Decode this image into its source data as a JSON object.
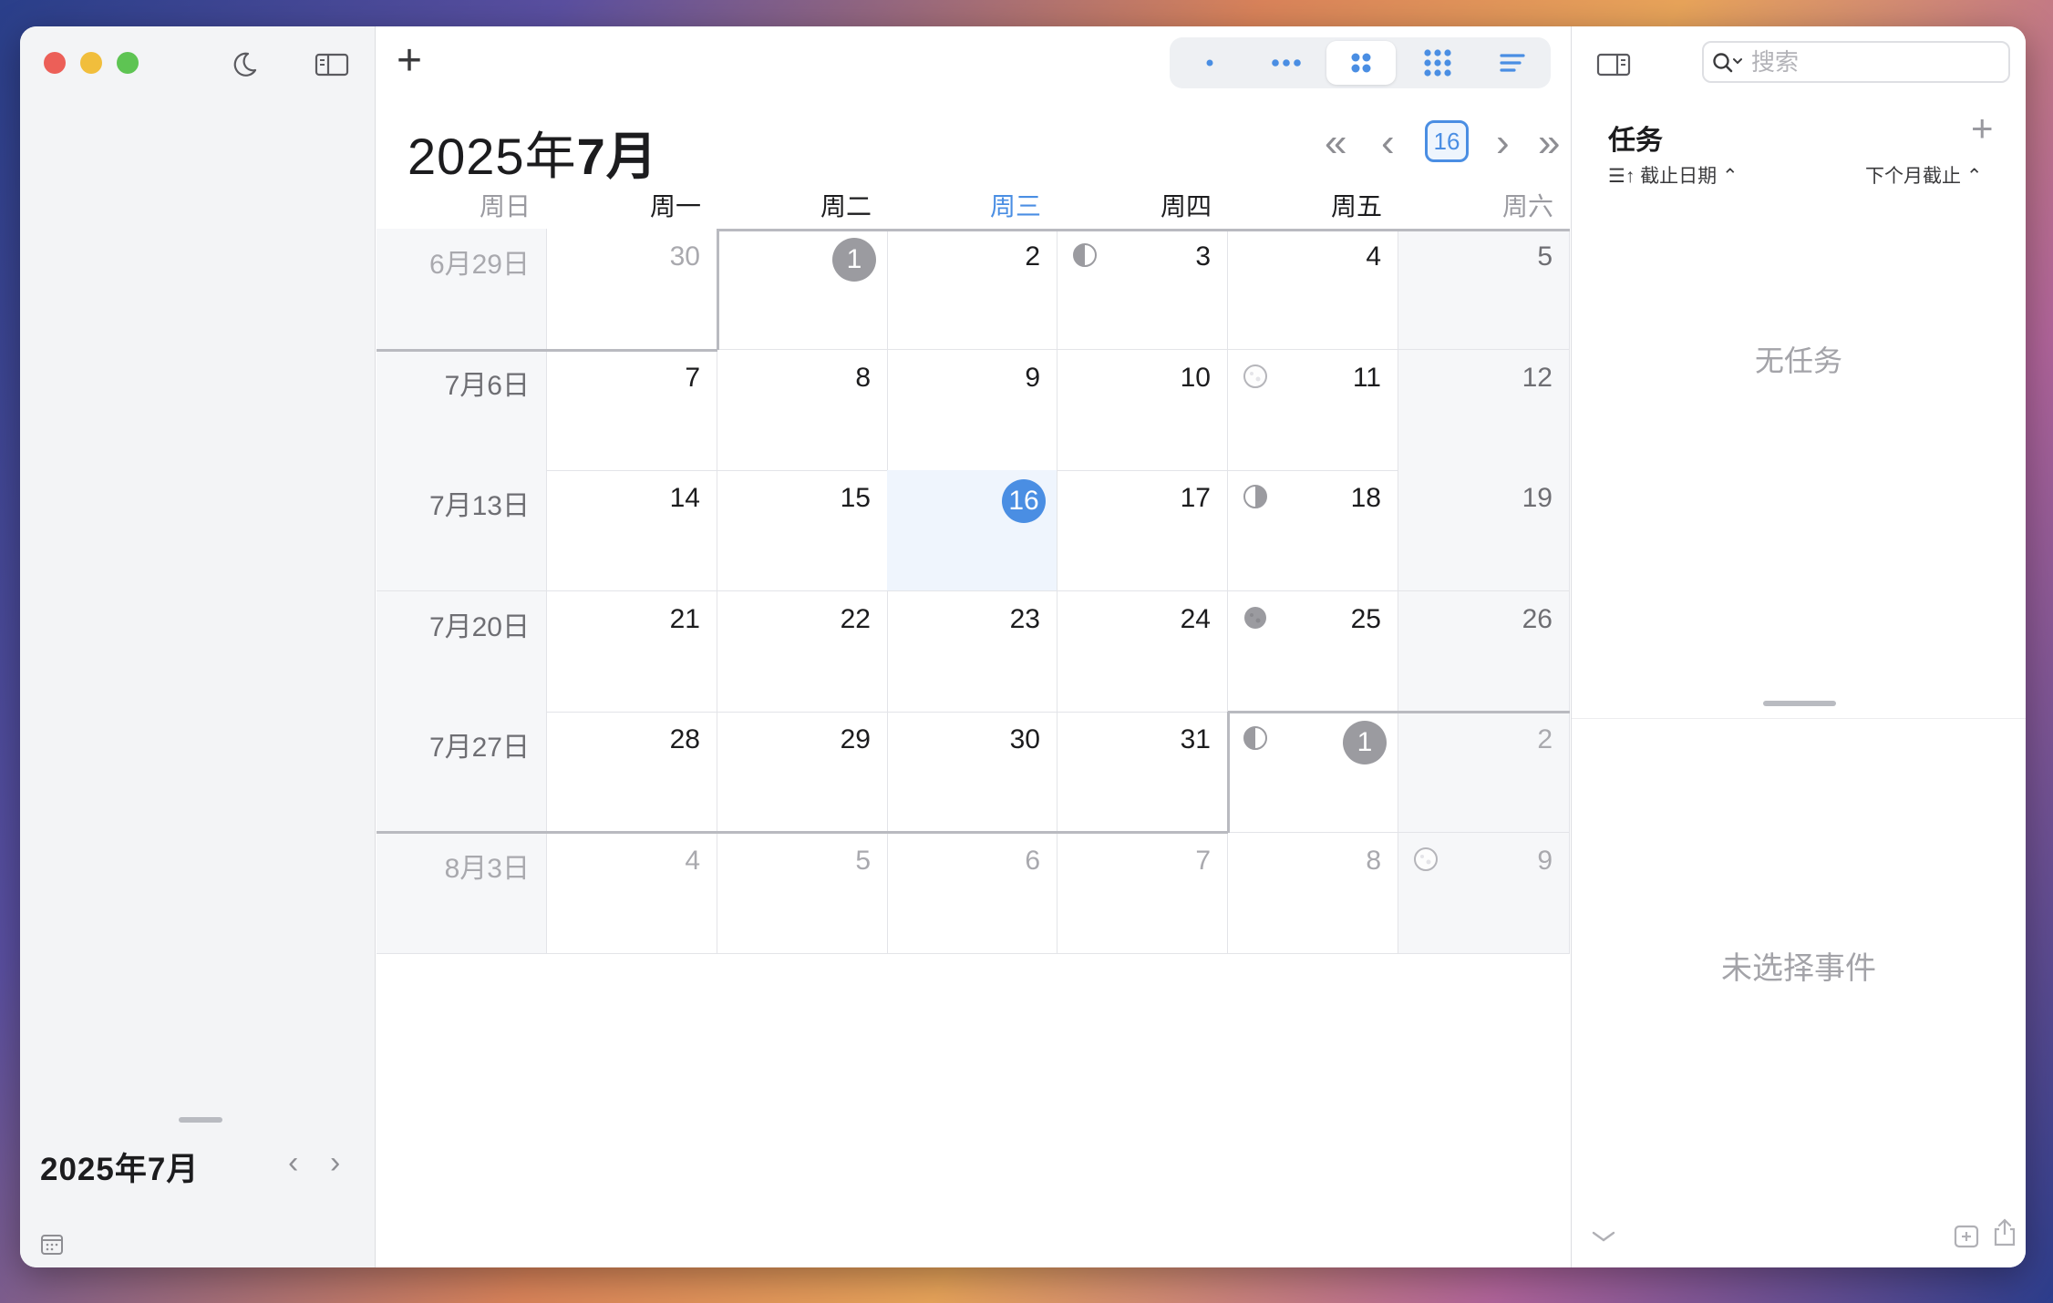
{
  "window": {
    "title": "2025年7月"
  },
  "toolbar": {
    "add_label": "+",
    "view_modes": [
      {
        "name": "view-day",
        "icon": "single-dot-icon",
        "active": false
      },
      {
        "name": "view-week",
        "icon": "three-dots-icon",
        "active": false
      },
      {
        "name": "view-month",
        "icon": "four-dots-icon",
        "active": true
      },
      {
        "name": "view-year",
        "icon": "nine-dots-icon",
        "active": false
      },
      {
        "name": "view-list",
        "icon": "lines-icon",
        "active": false
      }
    ]
  },
  "header": {
    "year_part": "2025年",
    "month_part": "7月",
    "today_badge": "16",
    "nav_prev_far": "«",
    "nav_prev": "‹",
    "nav_next": "›",
    "nav_next_far": "»"
  },
  "weekdays": [
    "周日",
    "周一",
    "周二",
    "周三",
    "周四",
    "周五",
    "周六"
  ],
  "weeks": [
    [
      {
        "label": "6月29日",
        "other": true
      },
      {
        "label": "30",
        "other": true
      },
      {
        "label": "1",
        "circle": true
      },
      {
        "label": "2"
      },
      {
        "label": "3",
        "moon": "first-quarter"
      },
      {
        "label": "4"
      },
      {
        "label": "5"
      }
    ],
    [
      {
        "label": "7月6日"
      },
      {
        "label": "7"
      },
      {
        "label": "8"
      },
      {
        "label": "9"
      },
      {
        "label": "10"
      },
      {
        "label": "11",
        "moon": "full"
      },
      {
        "label": "12"
      }
    ],
    [
      {
        "label": "7月13日"
      },
      {
        "label": "14"
      },
      {
        "label": "15"
      },
      {
        "label": "16",
        "today": true
      },
      {
        "label": "17"
      },
      {
        "label": "18",
        "moon": "last-quarter"
      },
      {
        "label": "19"
      }
    ],
    [
      {
        "label": "7月20日"
      },
      {
        "label": "21"
      },
      {
        "label": "22"
      },
      {
        "label": "23"
      },
      {
        "label": "24"
      },
      {
        "label": "25",
        "moon": "new"
      },
      {
        "label": "26"
      }
    ],
    [
      {
        "label": "7月27日"
      },
      {
        "label": "28"
      },
      {
        "label": "29"
      },
      {
        "label": "30"
      },
      {
        "label": "31"
      },
      {
        "label": "1",
        "circle": true,
        "moon": "first-quarter"
      },
      {
        "label": "2",
        "other": true
      }
    ],
    [
      {
        "label": "8月3日",
        "other": true
      },
      {
        "label": "4",
        "other": true
      },
      {
        "label": "5",
        "other": true
      },
      {
        "label": "6",
        "other": true
      },
      {
        "label": "7",
        "other": true
      },
      {
        "label": "8",
        "other": true
      },
      {
        "label": "9",
        "other": true,
        "moon": "full"
      }
    ]
  ],
  "sidebar": {
    "mini_title": "2025年7月",
    "prev": "‹",
    "next": "›"
  },
  "tasks": {
    "title": "任务",
    "add": "+",
    "sort_label": "☰↑ 截止日期 ⌃",
    "filter_label": "下个月截止 ⌃",
    "empty_text": "无任务"
  },
  "search": {
    "placeholder": "搜索",
    "value": ""
  },
  "event_detail": {
    "empty_text": "未选择事件"
  },
  "colors": {
    "accent": "#4a8ee3",
    "circle_gray": "#9b9ba0",
    "weekend_bg": "#f6f7f9",
    "today_bg": "#eff5fd"
  }
}
